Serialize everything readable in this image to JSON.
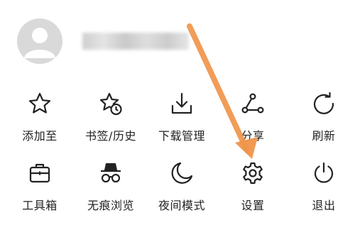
{
  "profile": {
    "username": "●●●●●●●●"
  },
  "menu": {
    "rows": [
      [
        {
          "icon": "star-icon",
          "label": "添加至"
        },
        {
          "icon": "bookmark-history-icon",
          "label": "书签/历史"
        },
        {
          "icon": "download-icon",
          "label": "下载管理"
        },
        {
          "icon": "share-icon",
          "label": "分享"
        },
        {
          "icon": "refresh-icon",
          "label": "刷新"
        }
      ],
      [
        {
          "icon": "toolbox-icon",
          "label": "工具箱"
        },
        {
          "icon": "incognito-icon",
          "label": "无痕浏览"
        },
        {
          "icon": "moon-icon",
          "label": "夜间模式"
        },
        {
          "icon": "gear-icon",
          "label": "设置"
        },
        {
          "icon": "power-icon",
          "label": "退出"
        }
      ]
    ]
  },
  "annotation": {
    "arrow_color": "#f0954a",
    "target": "设置"
  }
}
